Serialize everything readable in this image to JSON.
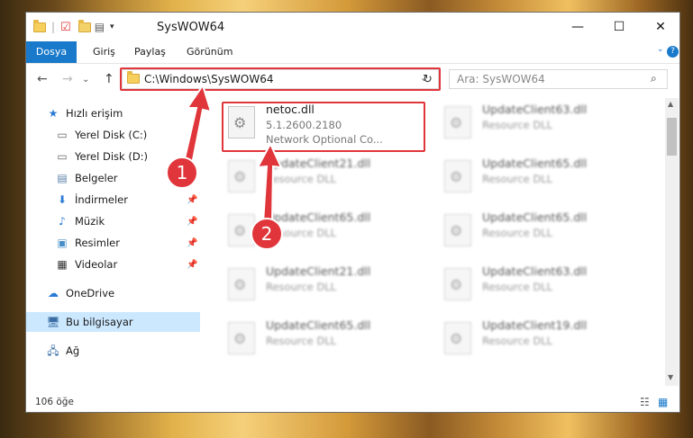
{
  "window": {
    "title": "SysWOW64",
    "min_label": "—",
    "max_label": "☐",
    "close_label": "✕"
  },
  "ribbon": {
    "tabs": [
      {
        "label": "Dosya"
      },
      {
        "label": "Giriş"
      },
      {
        "label": "Paylaş"
      },
      {
        "label": "Görünüm"
      }
    ],
    "help_icon": "?"
  },
  "address": {
    "path": "C:\\Windows\\SysWOW64",
    "search_placeholder": "Ara: SysWOW64"
  },
  "nav": {
    "items": [
      {
        "label": "Hızlı erişim"
      },
      {
        "label": "Yerel Disk (C:)"
      },
      {
        "label": "Yerel Disk (D:)"
      },
      {
        "label": "Belgeler"
      },
      {
        "label": "İndirmeler"
      },
      {
        "label": "Müzik"
      },
      {
        "label": "Resimler"
      },
      {
        "label": "Videolar"
      },
      {
        "label": "OneDrive"
      },
      {
        "label": "Bu bilgisayar"
      },
      {
        "label": "Ağ"
      }
    ]
  },
  "files": {
    "highlighted": {
      "name": "netoc.dll",
      "version": "5.1.2600.2180",
      "desc": "Network Optional Co..."
    },
    "items": [
      {
        "name": "UpdateClient63.dll",
        "desc": "Resource DLL"
      },
      {
        "name": "UpdateClient21.dll",
        "desc": "Resource DLL"
      },
      {
        "name": "UpdateClient65.dll",
        "desc": "Resource DLL"
      },
      {
        "name": "UpdateClient65.dll",
        "desc": "Resource DLL"
      },
      {
        "name": "UpdateClient65.dll",
        "desc": "Resource DLL"
      },
      {
        "name": "UpdateClient21.dll",
        "desc": "Resource DLL"
      },
      {
        "name": "UpdateClient63.dll",
        "desc": "Resource DLL"
      },
      {
        "name": "UpdateClient65.dll",
        "desc": "Resource DLL"
      },
      {
        "name": "UpdateClient19.dll",
        "desc": "Resource DLL"
      }
    ]
  },
  "status": {
    "count": "106 öğe"
  },
  "markers": {
    "one": "1",
    "two": "2"
  },
  "colors": {
    "accent": "#1979ca",
    "highlight": "#e0353b",
    "selected": "#cce8ff"
  }
}
